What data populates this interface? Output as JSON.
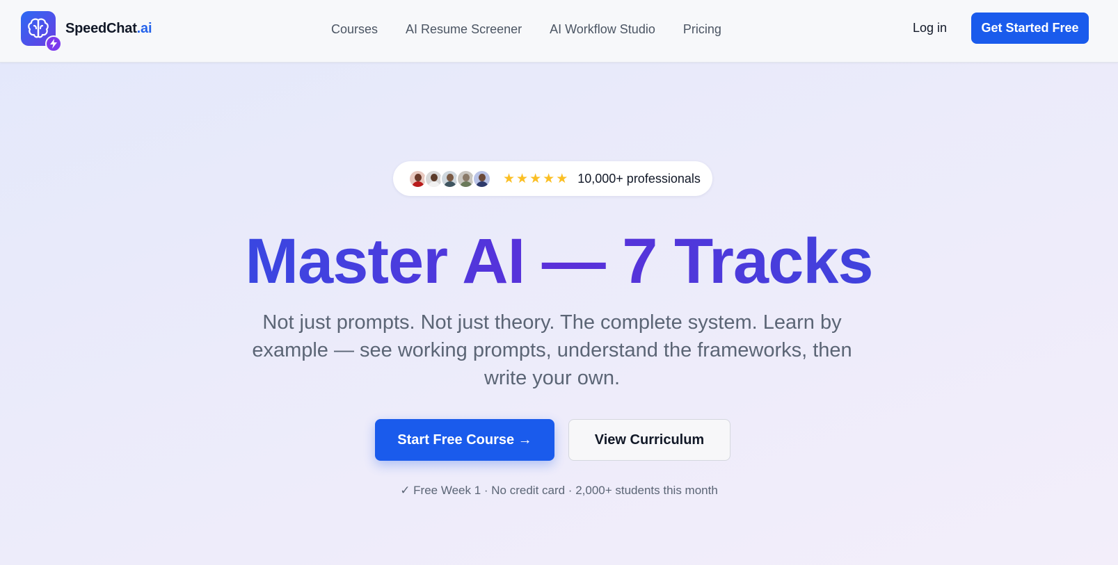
{
  "brand": {
    "name": "SpeedChat",
    "suffix": ".ai",
    "accent": "#2563eb",
    "logo_gradient": [
      "#2b6af3",
      "#6a3ee3"
    ],
    "badge_color": "#7c3aed"
  },
  "nav": {
    "items": [
      {
        "label": "Courses"
      },
      {
        "label": "AI Resume Screener"
      },
      {
        "label": "AI Workflow Studio"
      },
      {
        "label": "Pricing"
      }
    ],
    "login_label": "Log in",
    "cta_label": "Get Started Free"
  },
  "hero": {
    "badge": {
      "avatar_count": 5,
      "star_rating": 5,
      "star_color": "#fbbf24",
      "text": "10,000+ professionals"
    },
    "headline": "Master AI — 7 Tracks",
    "subtitle": "Not just prompts. Not just theory. The complete system. Learn by example — see working prompts, understand the frameworks, then write your own.",
    "primary_cta": "Start Free Course →",
    "secondary_cta": "View Curriculum",
    "note": "✓ Free Week 1 · No credit card · 2,000+ students this month"
  },
  "colors": {
    "primary_button": "#1a5bec",
    "headline_gradient": [
      "#1f5ae8",
      "#5b2fd9"
    ]
  }
}
